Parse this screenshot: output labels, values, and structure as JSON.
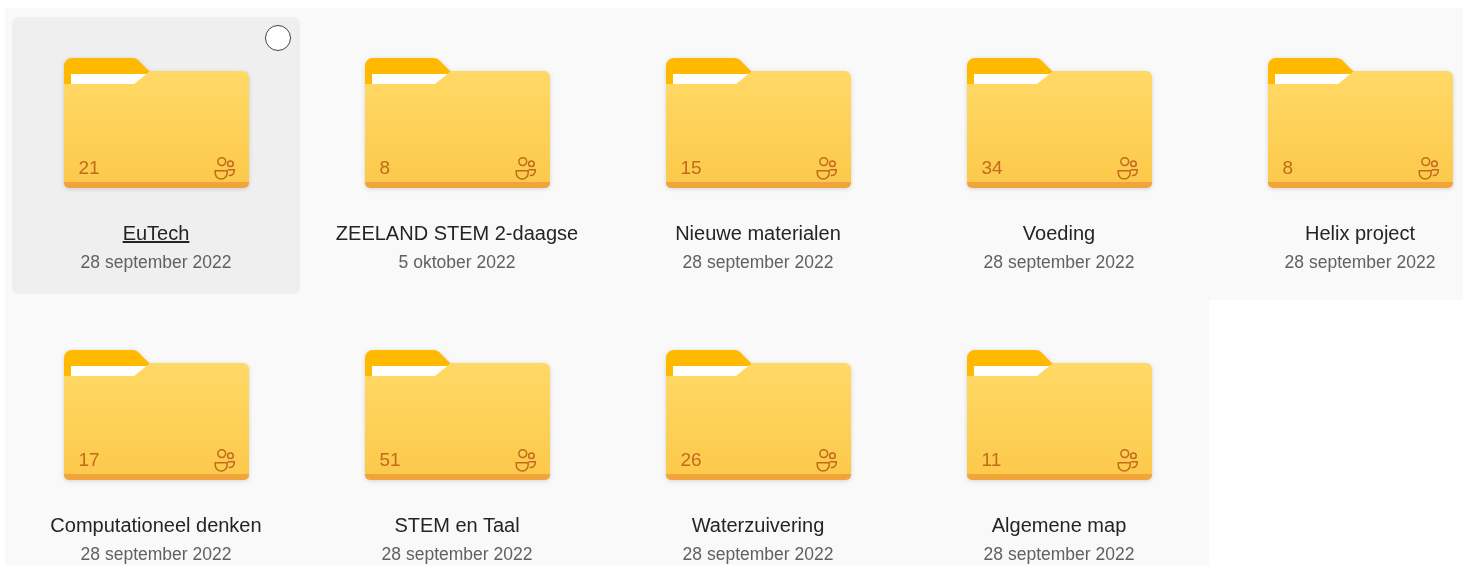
{
  "folders": [
    {
      "name": "EuTech",
      "date": "28 september 2022",
      "count": "21",
      "shared": true,
      "hovered": true,
      "checked": false
    },
    {
      "name": "ZEELAND STEM 2-daagse",
      "date": "5 oktober 2022",
      "count": "8",
      "shared": true,
      "hovered": false,
      "checked": false
    },
    {
      "name": "Nieuwe materialen",
      "date": "28 september 2022",
      "count": "15",
      "shared": true,
      "hovered": false,
      "checked": false
    },
    {
      "name": "Voeding",
      "date": "28 september 2022",
      "count": "34",
      "shared": true,
      "hovered": false,
      "checked": false
    },
    {
      "name": "Helix project",
      "date": "28 september 2022",
      "count": "8",
      "shared": true,
      "hovered": false,
      "checked": false
    },
    {
      "name": "Computationeel denken",
      "date": "28 september 2022",
      "count": "17",
      "shared": true,
      "hovered": false,
      "checked": false
    },
    {
      "name": "STEM en Taal",
      "date": "28 september 2022",
      "count": "51",
      "shared": true,
      "hovered": false,
      "checked": false
    },
    {
      "name": "Waterzuivering",
      "date": "28 september 2022",
      "count": "26",
      "shared": true,
      "hovered": false,
      "checked": false
    },
    {
      "name": "Algemene map",
      "date": "28 september 2022",
      "count": "11",
      "shared": true,
      "hovered": false,
      "checked": false
    }
  ]
}
